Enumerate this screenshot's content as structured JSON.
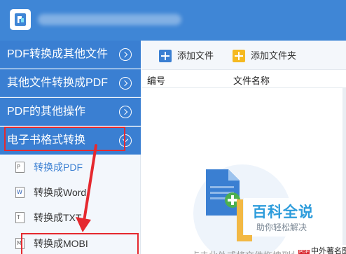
{
  "sidebar": {
    "categories": [
      {
        "label": "PDF转换成其他文件"
      },
      {
        "label": "其他文件转换成PDF"
      },
      {
        "label": "PDF的其他操作"
      },
      {
        "label": "电子书格式转换"
      }
    ],
    "subitems": [
      {
        "label": "转换成PDF",
        "icon": "P"
      },
      {
        "label": "转换成Word",
        "icon": "W"
      },
      {
        "label": "转换成TXT",
        "icon": "T"
      },
      {
        "label": "转换成MOBI",
        "icon": "M"
      }
    ]
  },
  "toolbar": {
    "add_file": "添加文件",
    "add_folder": "添加文件夹"
  },
  "table": {
    "col_num": "编号",
    "col_name": "文件名称"
  },
  "empty": {
    "hint": "点击此处或将文件拖拽到此处"
  },
  "watermark": {
    "title": "百科全说",
    "subtitle": "助你轻松解决",
    "note": "中外著名图"
  },
  "colors": {
    "accent": "#3a7fd2",
    "titlebar": "#3f86d6",
    "highlight": "#e5292f",
    "folder": "#f5b920"
  }
}
